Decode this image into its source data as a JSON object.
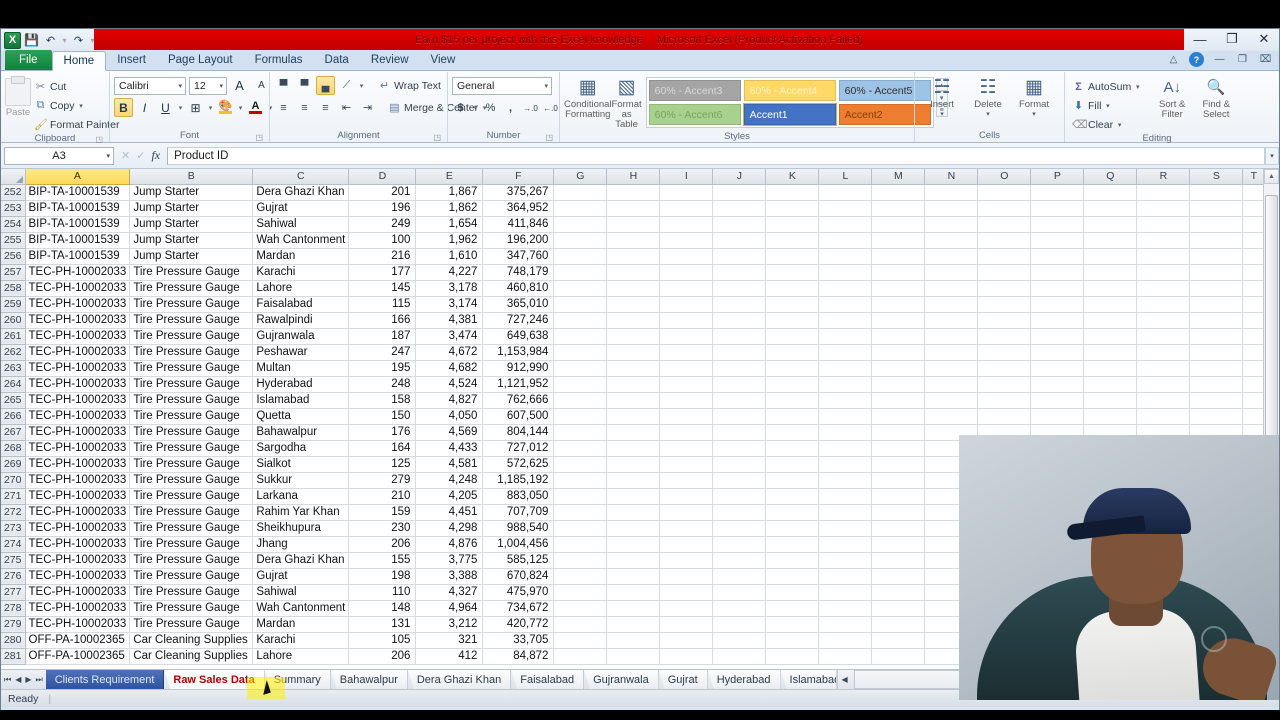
{
  "window": {
    "title_promo": "Earn $15 per project with this Excel knowledge",
    "title_app": "Microsoft Excel (Product Activation Failed)",
    "minimize": "—",
    "restore": "❐",
    "close": "✕"
  },
  "quick_access": {
    "logo": "X",
    "save_icon": "💾",
    "undo_icon": "↶",
    "redo_icon": "↷",
    "dropdown_icon": "▾",
    "sep": "·"
  },
  "ribbon": {
    "tabs": [
      {
        "label": "File",
        "state": "file"
      },
      {
        "label": "Home",
        "state": "active"
      },
      {
        "label": "Insert",
        "state": "normal"
      },
      {
        "label": "Page Layout",
        "state": "normal"
      },
      {
        "label": "Formulas",
        "state": "normal"
      },
      {
        "label": "Data",
        "state": "normal"
      },
      {
        "label": "Review",
        "state": "normal"
      },
      {
        "label": "View",
        "state": "normal"
      }
    ],
    "help_icons": {
      "minimize_ribbon": "△",
      "help": "?",
      "restore_win": "❐",
      "close_win": "⌧",
      "min_win": "—"
    },
    "clipboard": {
      "group_label": "Clipboard",
      "paste": "Paste",
      "cut": "Cut",
      "copy": "Copy",
      "format_painter": "Format Painter",
      "cut_icon": "✂",
      "copy_icon": "⧉",
      "painter_icon": "🖌",
      "dialog_launcher": "◳"
    },
    "font": {
      "group_label": "Font",
      "font_name": "Calibri",
      "font_size": "12",
      "grow_font": "A",
      "shrink_font": "A",
      "bold": "B",
      "italic": "I",
      "underline": "U",
      "borders_icon": "⊞",
      "fill_color_icon": "🎨",
      "font_color_icon": "A",
      "dialog_launcher": "◳"
    },
    "alignment": {
      "group_label": "Alignment",
      "top_align": "▀",
      "middle_align": "▀",
      "bottom_align": "▄",
      "orientation_icon": "⟋",
      "align_left": "≡",
      "align_center": "≡",
      "align_right": "≡",
      "decrease_indent": "⇤",
      "increase_indent": "⇥",
      "wrap_text": "Wrap Text",
      "merge_center": "Merge & Center",
      "wrap_icon": "↵",
      "merge_icon": "▤",
      "dialog_launcher": "◳"
    },
    "number": {
      "group_label": "Number",
      "format": "General",
      "currency": "$",
      "percent": "%",
      "comma": ",",
      "increase_decimal": "→.0",
      "decrease_decimal": "←.0",
      "dialog_launcher": "◳"
    },
    "styles": {
      "group_label": "Styles",
      "conditional_formatting": "Conditional Formatting",
      "format_as_table": "Format as Table",
      "gallery": [
        {
          "label": "60% - Accent3",
          "bg": "#a5a5a5",
          "fg": "#d9d9d9"
        },
        {
          "label": "60% - Accent4",
          "bg": "#ffd966",
          "fg": "#fff2cc"
        },
        {
          "label": "60% - Accent5",
          "bg": "#9dc3e6",
          "fg": "#2f2f2f"
        },
        {
          "label": "60% - Accent6",
          "bg": "#a9d18e",
          "fg": "#7aa35c"
        },
        {
          "label": "Accent1",
          "bg": "#4472c4",
          "fg": "#ffffff"
        },
        {
          "label": "Accent2",
          "bg": "#ed7d31",
          "fg": "#8a3d08"
        }
      ],
      "scroll_up": "▴",
      "scroll_down": "▾",
      "more": "≡"
    },
    "cells": {
      "group_label": "Cells",
      "insert": "Insert",
      "delete": "Delete",
      "format": "Format",
      "insert_icon": "➕",
      "delete_icon": "✖",
      "format_icon": "▦"
    },
    "editing": {
      "group_label": "Editing",
      "autosum": "AutoSum",
      "fill": "Fill",
      "clear": "Clear",
      "sort_filter": "Sort & Filter",
      "find_select": "Find & Select",
      "autosum_icon": "Σ",
      "fill_icon": "⬇",
      "clear_icon": "⌫",
      "sort_icon": "↕",
      "find_icon": "🔍"
    }
  },
  "formula_bar": {
    "name_box": "A3",
    "dropdown_icon": "▾",
    "cancel_icon": "✕",
    "enter_icon": "✓",
    "fx_icon": "fx",
    "value": "Product ID",
    "expand_icon": "▾"
  },
  "grid": {
    "columns": [
      "A",
      "B",
      "C",
      "D",
      "E",
      "F",
      "G",
      "H",
      "I",
      "J",
      "K",
      "L",
      "M",
      "N",
      "O",
      "P",
      "Q",
      "R",
      "S",
      "T"
    ],
    "selected_column": "A",
    "rows": [
      {
        "n": "252",
        "a": "BIP-TA-10001539",
        "b": "Jump Starter",
        "c": "Dera Ghazi Khan",
        "d": "201",
        "e": "1,867",
        "f": "375,267"
      },
      {
        "n": "253",
        "a": "BIP-TA-10001539",
        "b": "Jump Starter",
        "c": "Gujrat",
        "d": "196",
        "e": "1,862",
        "f": "364,952"
      },
      {
        "n": "254",
        "a": "BIP-TA-10001539",
        "b": "Jump Starter",
        "c": "Sahiwal",
        "d": "249",
        "e": "1,654",
        "f": "411,846"
      },
      {
        "n": "255",
        "a": "BIP-TA-10001539",
        "b": "Jump Starter",
        "c": "Wah Cantonment",
        "d": "100",
        "e": "1,962",
        "f": "196,200"
      },
      {
        "n": "256",
        "a": "BIP-TA-10001539",
        "b": "Jump Starter",
        "c": "Mardan",
        "d": "216",
        "e": "1,610",
        "f": "347,760"
      },
      {
        "n": "257",
        "a": "TEC-PH-10002033",
        "b": "Tire Pressure Gauge",
        "c": "Karachi",
        "d": "177",
        "e": "4,227",
        "f": "748,179"
      },
      {
        "n": "258",
        "a": "TEC-PH-10002033",
        "b": "Tire Pressure Gauge",
        "c": "Lahore",
        "d": "145",
        "e": "3,178",
        "f": "460,810"
      },
      {
        "n": "259",
        "a": "TEC-PH-10002033",
        "b": "Tire Pressure Gauge",
        "c": "Faisalabad",
        "d": "115",
        "e": "3,174",
        "f": "365,010"
      },
      {
        "n": "260",
        "a": "TEC-PH-10002033",
        "b": "Tire Pressure Gauge",
        "c": "Rawalpindi",
        "d": "166",
        "e": "4,381",
        "f": "727,246"
      },
      {
        "n": "261",
        "a": "TEC-PH-10002033",
        "b": "Tire Pressure Gauge",
        "c": "Gujranwala",
        "d": "187",
        "e": "3,474",
        "f": "649,638"
      },
      {
        "n": "262",
        "a": "TEC-PH-10002033",
        "b": "Tire Pressure Gauge",
        "c": "Peshawar",
        "d": "247",
        "e": "4,672",
        "f": "1,153,984"
      },
      {
        "n": "263",
        "a": "TEC-PH-10002033",
        "b": "Tire Pressure Gauge",
        "c": "Multan",
        "d": "195",
        "e": "4,682",
        "f": "912,990"
      },
      {
        "n": "264",
        "a": "TEC-PH-10002033",
        "b": "Tire Pressure Gauge",
        "c": "Hyderabad",
        "d": "248",
        "e": "4,524",
        "f": "1,121,952"
      },
      {
        "n": "265",
        "a": "TEC-PH-10002033",
        "b": "Tire Pressure Gauge",
        "c": "Islamabad",
        "d": "158",
        "e": "4,827",
        "f": "762,666"
      },
      {
        "n": "266",
        "a": "TEC-PH-10002033",
        "b": "Tire Pressure Gauge",
        "c": "Quetta",
        "d": "150",
        "e": "4,050",
        "f": "607,500"
      },
      {
        "n": "267",
        "a": "TEC-PH-10002033",
        "b": "Tire Pressure Gauge",
        "c": "Bahawalpur",
        "d": "176",
        "e": "4,569",
        "f": "804,144"
      },
      {
        "n": "268",
        "a": "TEC-PH-10002033",
        "b": "Tire Pressure Gauge",
        "c": "Sargodha",
        "d": "164",
        "e": "4,433",
        "f": "727,012"
      },
      {
        "n": "269",
        "a": "TEC-PH-10002033",
        "b": "Tire Pressure Gauge",
        "c": "Sialkot",
        "d": "125",
        "e": "4,581",
        "f": "572,625"
      },
      {
        "n": "270",
        "a": "TEC-PH-10002033",
        "b": "Tire Pressure Gauge",
        "c": "Sukkur",
        "d": "279",
        "e": "4,248",
        "f": "1,185,192"
      },
      {
        "n": "271",
        "a": "TEC-PH-10002033",
        "b": "Tire Pressure Gauge",
        "c": "Larkana",
        "d": "210",
        "e": "4,205",
        "f": "883,050"
      },
      {
        "n": "272",
        "a": "TEC-PH-10002033",
        "b": "Tire Pressure Gauge",
        "c": "Rahim Yar Khan",
        "d": "159",
        "e": "4,451",
        "f": "707,709"
      },
      {
        "n": "273",
        "a": "TEC-PH-10002033",
        "b": "Tire Pressure Gauge",
        "c": "Sheikhupura",
        "d": "230",
        "e": "4,298",
        "f": "988,540"
      },
      {
        "n": "274",
        "a": "TEC-PH-10002033",
        "b": "Tire Pressure Gauge",
        "c": "Jhang",
        "d": "206",
        "e": "4,876",
        "f": "1,004,456"
      },
      {
        "n": "275",
        "a": "TEC-PH-10002033",
        "b": "Tire Pressure Gauge",
        "c": "Dera Ghazi Khan",
        "d": "155",
        "e": "3,775",
        "f": "585,125"
      },
      {
        "n": "276",
        "a": "TEC-PH-10002033",
        "b": "Tire Pressure Gauge",
        "c": "Gujrat",
        "d": "198",
        "e": "3,388",
        "f": "670,824"
      },
      {
        "n": "277",
        "a": "TEC-PH-10002033",
        "b": "Tire Pressure Gauge",
        "c": "Sahiwal",
        "d": "110",
        "e": "4,327",
        "f": "475,970"
      },
      {
        "n": "278",
        "a": "TEC-PH-10002033",
        "b": "Tire Pressure Gauge",
        "c": "Wah Cantonment",
        "d": "148",
        "e": "4,964",
        "f": "734,672"
      },
      {
        "n": "279",
        "a": "TEC-PH-10002033",
        "b": "Tire Pressure Gauge",
        "c": "Mardan",
        "d": "131",
        "e": "3,212",
        "f": "420,772"
      },
      {
        "n": "280",
        "a": "OFF-PA-10002365",
        "b": "Car Cleaning Supplies",
        "c": "Karachi",
        "d": "105",
        "e": "321",
        "f": "33,705"
      },
      {
        "n": "281",
        "a": "OFF-PA-10002365",
        "b": "Car Cleaning Supplies",
        "c": "Lahore",
        "d": "206",
        "e": "412",
        "f": "84,872"
      }
    ]
  },
  "sheet_tabs": {
    "nav": {
      "first": "⏮",
      "prev": "◀",
      "next": "▶",
      "last": "⏭"
    },
    "tabs": [
      {
        "label": "Clients Requirement",
        "state": "selblue"
      },
      {
        "label": "Raw Sales Data",
        "state": "active"
      },
      {
        "label": "Summary",
        "state": "normal"
      },
      {
        "label": "Bahawalpur",
        "state": "normal"
      },
      {
        "label": "Dera Ghazi Khan",
        "state": "normal"
      },
      {
        "label": "Faisalabad",
        "state": "normal"
      },
      {
        "label": "Gujranwala",
        "state": "normal"
      },
      {
        "label": "Gujrat",
        "state": "normal"
      },
      {
        "label": "Hyderabad",
        "state": "normal"
      },
      {
        "label": "Islamabad",
        "state": "clipped"
      }
    ],
    "scroll_left": "◀"
  },
  "status_bar": {
    "status": "Ready"
  }
}
